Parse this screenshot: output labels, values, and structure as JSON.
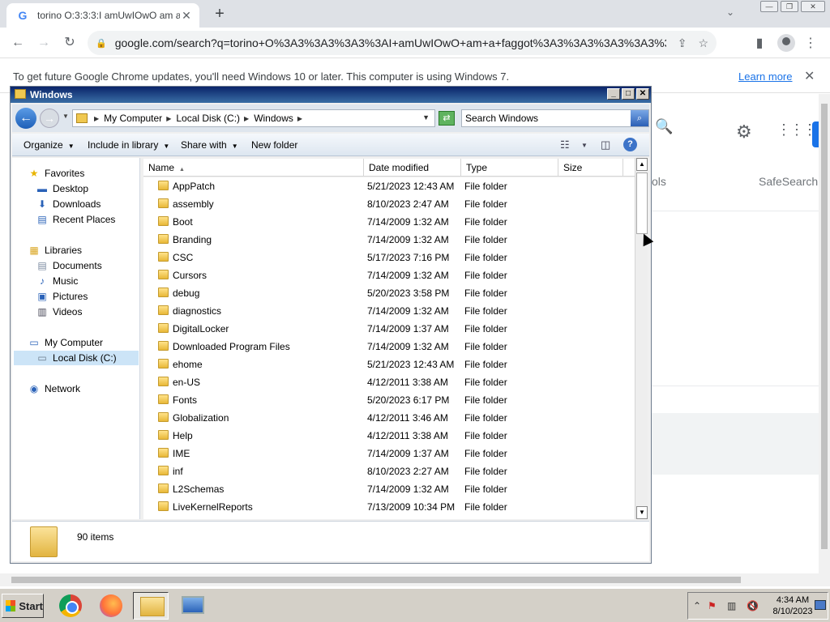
{
  "browser": {
    "tab_title": "torino O:3:3:3:I amUwIOwO am a",
    "tab_favicon": "G",
    "url": "google.com/search?q=torino+O%3A3%3A3%3A3%3AI+amUwIOwO+am+a+faggot%3A3%3A3%3A3%3A3%3A...",
    "infobar_message": "To get future Google Chrome updates, you'll need Windows 10 or later. This computer is using Windows 7.",
    "infobar_link": "Learn more",
    "page_tools_fragment": "ols",
    "page_safesearch": "SafeSearch"
  },
  "explorer": {
    "title": "Windows",
    "breadcrumbs": [
      "My Computer",
      "Local Disk (C:)",
      "Windows"
    ],
    "search_placeholder": "Search Windows",
    "commands": {
      "organize": "Organize",
      "include_in_library": "Include in library",
      "share_with": "Share with",
      "new_folder": "New folder"
    },
    "nav": {
      "favorites": "Favorites",
      "desktop": "Desktop",
      "downloads": "Downloads",
      "recent_places": "Recent Places",
      "libraries": "Libraries",
      "documents": "Documents",
      "music": "Music",
      "pictures": "Pictures",
      "videos": "Videos",
      "my_computer": "My Computer",
      "local_disk": "Local Disk (C:)",
      "network": "Network"
    },
    "columns": {
      "name": "Name",
      "date_modified": "Date modified",
      "type": "Type",
      "size": "Size"
    },
    "rows": [
      {
        "name": "AppPatch",
        "date": "5/21/2023 12:43 AM",
        "type": "File folder"
      },
      {
        "name": "assembly",
        "date": "8/10/2023 2:47 AM",
        "type": "File folder"
      },
      {
        "name": "Boot",
        "date": "7/14/2009 1:32 AM",
        "type": "File folder"
      },
      {
        "name": "Branding",
        "date": "7/14/2009 1:32 AM",
        "type": "File folder"
      },
      {
        "name": "CSC",
        "date": "5/17/2023 7:16 PM",
        "type": "File folder"
      },
      {
        "name": "Cursors",
        "date": "7/14/2009 1:32 AM",
        "type": "File folder"
      },
      {
        "name": "debug",
        "date": "5/20/2023 3:58 PM",
        "type": "File folder"
      },
      {
        "name": "diagnostics",
        "date": "7/14/2009 1:32 AM",
        "type": "File folder"
      },
      {
        "name": "DigitalLocker",
        "date": "7/14/2009 1:37 AM",
        "type": "File folder"
      },
      {
        "name": "Downloaded Program Files",
        "date": "7/14/2009 1:32 AM",
        "type": "File folder"
      },
      {
        "name": "ehome",
        "date": "5/21/2023 12:43 AM",
        "type": "File folder"
      },
      {
        "name": "en-US",
        "date": "4/12/2011 3:38 AM",
        "type": "File folder"
      },
      {
        "name": "Fonts",
        "date": "5/20/2023 6:17 PM",
        "type": "File folder"
      },
      {
        "name": "Globalization",
        "date": "4/12/2011 3:46 AM",
        "type": "File folder"
      },
      {
        "name": "Help",
        "date": "4/12/2011 3:38 AM",
        "type": "File folder"
      },
      {
        "name": "IME",
        "date": "7/14/2009 1:37 AM",
        "type": "File folder"
      },
      {
        "name": "inf",
        "date": "8/10/2023 2:27 AM",
        "type": "File folder"
      },
      {
        "name": "L2Schemas",
        "date": "7/14/2009 1:32 AM",
        "type": "File folder"
      },
      {
        "name": "LiveKernelReports",
        "date": "7/13/2009 10:34 PM",
        "type": "File folder"
      }
    ],
    "status_count": "90 items"
  },
  "taskbar": {
    "start_label": "Start",
    "time": "4:34 AM",
    "date": "8/10/2023"
  },
  "colors": {
    "chrome_tabstrip": "#dee1e6",
    "link_blue": "#1a73e8",
    "explorer_title": "#0a246a",
    "taskbar": "#d4d0c8"
  }
}
